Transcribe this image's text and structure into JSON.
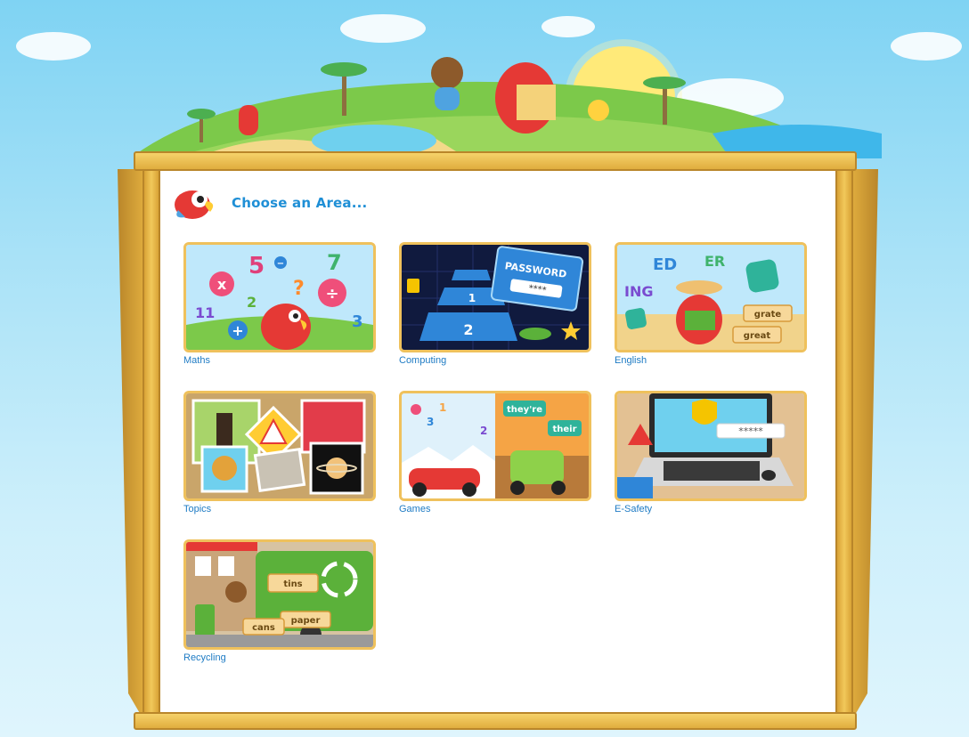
{
  "header": {
    "title": "Choose an Area..."
  },
  "areas": [
    {
      "label": "Maths",
      "icon": "maths-thumbnail"
    },
    {
      "label": "Computing",
      "icon": "computing-thumbnail"
    },
    {
      "label": "English",
      "icon": "english-thumbnail"
    },
    {
      "label": "Topics",
      "icon": "topics-thumbnail"
    },
    {
      "label": "Games",
      "icon": "games-thumbnail"
    },
    {
      "label": "E-Safety",
      "icon": "esafety-thumbnail"
    },
    {
      "label": "Recycling",
      "icon": "recycling-thumbnail"
    }
  ],
  "thumb_text": {
    "maths_nums": [
      "5",
      "7",
      "2",
      "3",
      "11",
      "?"
    ],
    "maths_ops": [
      "x",
      "÷",
      "+",
      "−"
    ],
    "computing_password": "PASSWORD",
    "computing_stars": "****",
    "computing_steps": [
      "2",
      "1"
    ],
    "english_words": [
      "ED",
      "ER",
      "ING",
      "grate",
      "great"
    ],
    "games_words": [
      "they're",
      "their"
    ],
    "games_nums": [
      "3",
      "1",
      "2"
    ],
    "esafety_password": "*****",
    "recycling_words": [
      "tins",
      "paper",
      "cans"
    ]
  },
  "colors": {
    "accent": "#1f8fd6",
    "frame": "#efc15c",
    "sky": "#7fd3f3"
  }
}
